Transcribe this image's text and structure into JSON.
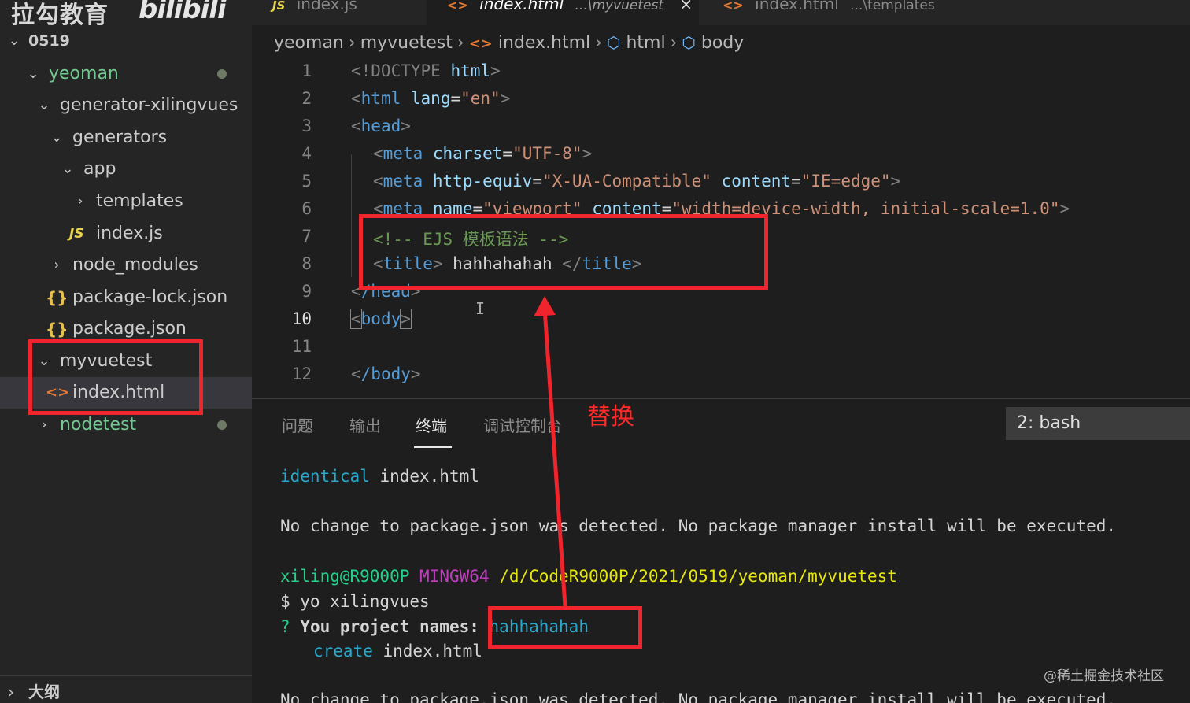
{
  "branding": {
    "logo_text": "拉勾教育",
    "bili_text": "bilibili"
  },
  "tabs": [
    {
      "label": "index.js",
      "icon": "js-icon"
    },
    {
      "label": "index.html",
      "path": "...\\myvuetest",
      "icon": "html-icon",
      "active": true
    },
    {
      "label": "index.html",
      "path": "...\\templates",
      "icon": "html-icon"
    }
  ],
  "tab_close": "×",
  "breadcrumb": [
    "yeoman",
    "myvuetest",
    "index.html",
    "html",
    "body"
  ],
  "explorer": {
    "root": "0519",
    "items": [
      {
        "label": "yeoman",
        "kind": "folder",
        "expanded": true,
        "modified": true
      },
      {
        "label": "generator-xilingvues",
        "kind": "folder",
        "expanded": true
      },
      {
        "label": "generators",
        "kind": "folder",
        "expanded": true
      },
      {
        "label": "app",
        "kind": "folder",
        "expanded": true
      },
      {
        "label": "templates",
        "kind": "folder",
        "expanded": false
      },
      {
        "label": "index.js",
        "kind": "js"
      },
      {
        "label": "node_modules",
        "kind": "folder",
        "expanded": false
      },
      {
        "label": "package-lock.json",
        "kind": "json"
      },
      {
        "label": "package.json",
        "kind": "json"
      },
      {
        "label": "myvuetest",
        "kind": "folder",
        "expanded": true
      },
      {
        "label": "index.html",
        "kind": "html",
        "selected": true
      },
      {
        "label": "nodetest",
        "kind": "folder",
        "expanded": false,
        "modified": true
      }
    ],
    "outline_label": "大纲",
    "icons": {
      "js": "JS",
      "json": "{}",
      "html": "<>"
    }
  },
  "editor": {
    "current_line": 10,
    "line_numbers": [
      "1",
      "2",
      "3",
      "4",
      "5",
      "6",
      "7",
      "8",
      "9",
      "10",
      "11",
      "12"
    ],
    "code": {
      "l1_doctype": "<!DOCTYPE",
      "l1_html": "html",
      "l2_html": "html",
      "l2_attr": "lang",
      "l2_val": "\"en\"",
      "l3_head": "head",
      "l4_meta": "meta",
      "l4_attr": "charset",
      "l4_val": "\"UTF-8\"",
      "l5_meta": "meta",
      "l5_attr1": "http-equiv",
      "l5_val1": "\"X-UA-Compatible\"",
      "l5_attr2": "content",
      "l5_val2": "\"IE=edge\"",
      "l6_meta": "meta",
      "l6_attr1": "name",
      "l6_val1": "\"viewport\"",
      "l6_attr2": "content",
      "l6_val2": "\"width=device-width, initial-scale=1.0\"",
      "l7_comment": "<!-- EJS 模板语法 -->",
      "l8_title_tag": "title",
      "l8_title_text": " hahhahahah ",
      "l9_head": "/head",
      "l10_body": "body",
      "l12_body": "/body"
    }
  },
  "panel": {
    "tabs": [
      "问题",
      "输出",
      "终端",
      "调试控制台"
    ],
    "active_tab": "终端",
    "terminal_select": "2: bash",
    "terminal": {
      "line1_status": "identical",
      "line1_file": " index.html",
      "line2": "No change to package.json was detected. No package manager install will be executed.",
      "prompt_user": "xiling@R9000P",
      "prompt_env": "MINGW64",
      "prompt_path": "/d/CodeR9000P/2021/0519/yeoman/myvuetest",
      "command": "$ yo xilingvues",
      "question_mark": "?",
      "question": " You project names: ",
      "answer": "hahhahahah",
      "create_status": "create",
      "create_file": " index.html",
      "line_last": "No change to package.json was detected. No package manager install will be executed."
    }
  },
  "annotation": {
    "label": "替换",
    "color": "#f0242d"
  },
  "watermark": "@稀土掘金技术社区",
  "colors": {
    "sidebar_bg": "#252526",
    "editor_bg": "#1e1e1e",
    "annotation_red": "#f0242d"
  }
}
